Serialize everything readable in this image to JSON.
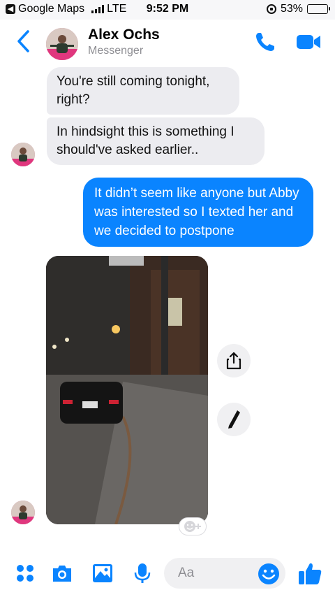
{
  "status_bar": {
    "back_app_label": "Google Maps",
    "network": "LTE",
    "time": "9:52 PM",
    "battery": "53%",
    "battery_level": 0.53
  },
  "header": {
    "contact_name": "Alex Ochs",
    "contact_subtitle": "Messenger",
    "back_icon": "chevron-left-icon",
    "call_icon": "phone-icon",
    "video_icon": "video-camera-icon"
  },
  "messages": [
    {
      "from": "contact",
      "text": "You're still coming tonight, right?"
    },
    {
      "from": "contact",
      "text": "In hindsight this is something I should've asked earlier.."
    },
    {
      "from": "me",
      "text": "It didn’t seem like anyone but Abby was interested so I texted her and we decided to postpone"
    },
    {
      "from": "contact",
      "type": "photo"
    }
  ],
  "photo_actions": {
    "share_icon": "share-icon",
    "edit_icon": "pencil-icon",
    "reaction_icon": "add-reaction-icon"
  },
  "composer": {
    "placeholder": "Aa",
    "icons": [
      "grid-dots-icon",
      "camera-icon",
      "photo-gallery-icon",
      "microphone-icon",
      "emoji-icon",
      "thumbs-up-icon"
    ]
  },
  "colors": {
    "accent": "#0a84ff",
    "incoming_bubble": "#ececf0",
    "avatar_ring": "#e0377e"
  }
}
